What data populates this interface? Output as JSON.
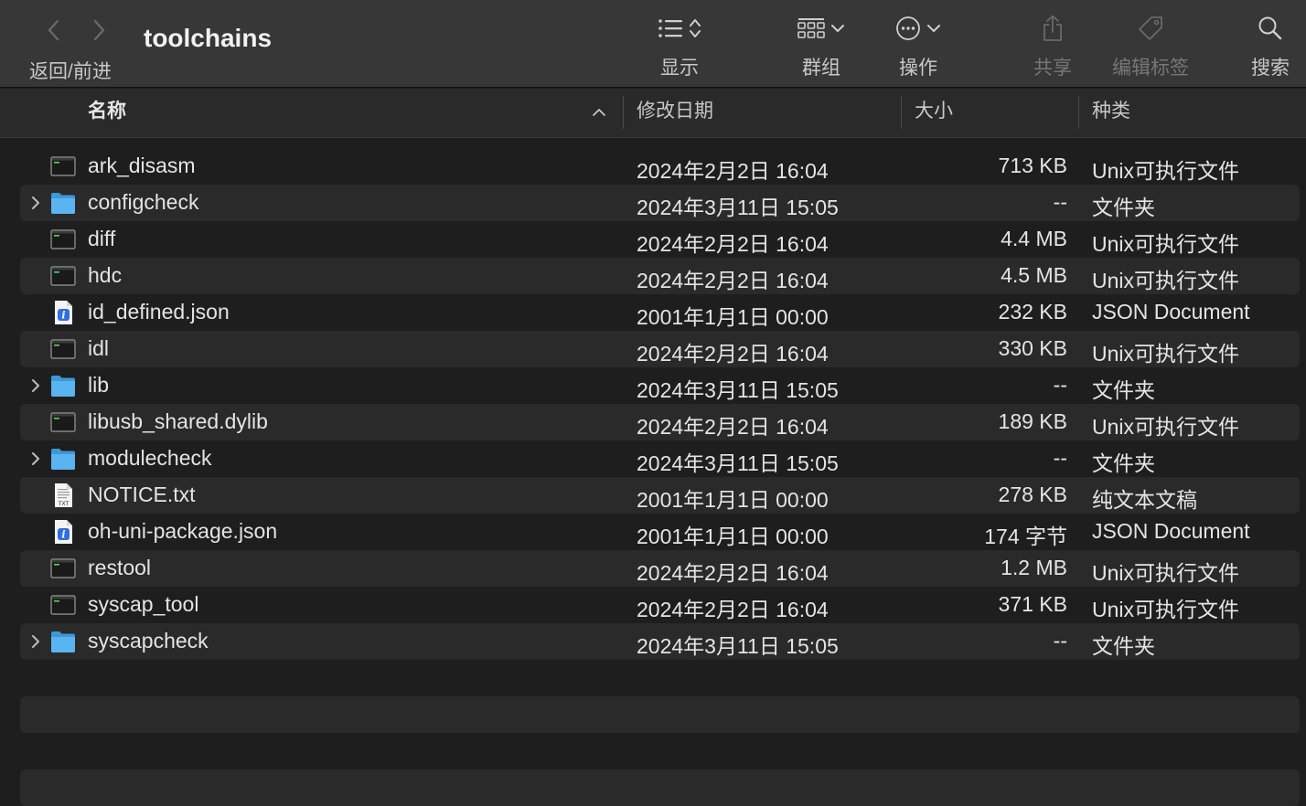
{
  "window": {
    "title": "toolchains",
    "nav_label": "返回/前进"
  },
  "toolbar": {
    "view_label": "显示",
    "group_label": "群组",
    "action_label": "操作",
    "share_label": "共享",
    "tags_label": "编辑标签",
    "search_label": "搜索"
  },
  "columns": {
    "name": "名称",
    "modified": "修改日期",
    "size": "大小",
    "kind": "种类"
  },
  "files": [
    {
      "name": "ark_disasm",
      "date": "2024年2月2日 16:04",
      "size": "713 KB",
      "kind": "Unix可执行文件",
      "icon": "exec-icon",
      "folder": false
    },
    {
      "name": "configcheck",
      "date": "2024年3月11日 15:05",
      "size": "--",
      "kind": "文件夹",
      "icon": "folder-icon",
      "folder": true
    },
    {
      "name": "diff",
      "date": "2024年2月2日 16:04",
      "size": "4.4 MB",
      "kind": "Unix可执行文件",
      "icon": "exec-icon",
      "folder": false
    },
    {
      "name": "hdc",
      "date": "2024年2月2日 16:04",
      "size": "4.5 MB",
      "kind": "Unix可执行文件",
      "icon": "exec-icon",
      "folder": false
    },
    {
      "name": "id_defined.json",
      "date": "2001年1月1日 00:00",
      "size": "232 KB",
      "kind": "JSON Document",
      "icon": "json-icon",
      "folder": false
    },
    {
      "name": "idl",
      "date": "2024年2月2日 16:04",
      "size": "330 KB",
      "kind": "Unix可执行文件",
      "icon": "exec-icon",
      "folder": false
    },
    {
      "name": "lib",
      "date": "2024年3月11日 15:05",
      "size": "--",
      "kind": "文件夹",
      "icon": "folder-icon",
      "folder": true
    },
    {
      "name": "libusb_shared.dylib",
      "date": "2024年2月2日 16:04",
      "size": "189 KB",
      "kind": "Unix可执行文件",
      "icon": "exec-icon",
      "folder": false
    },
    {
      "name": "modulecheck",
      "date": "2024年3月11日 15:05",
      "size": "--",
      "kind": "文件夹",
      "icon": "folder-icon",
      "folder": true
    },
    {
      "name": "NOTICE.txt",
      "date": "2001年1月1日 00:00",
      "size": "278 KB",
      "kind": "纯文本文稿",
      "icon": "txt-icon",
      "folder": false,
      "icon_text": "TXT"
    },
    {
      "name": "oh-uni-package.json",
      "date": "2001年1月1日 00:00",
      "size": "174 字节",
      "kind": "JSON Document",
      "icon": "json-icon",
      "folder": false
    },
    {
      "name": "restool",
      "date": "2024年2月2日 16:04",
      "size": "1.2 MB",
      "kind": "Unix可执行文件",
      "icon": "exec-icon",
      "folder": false
    },
    {
      "name": "syscap_tool",
      "date": "2024年2月2日 16:04",
      "size": "371 KB",
      "kind": "Unix可执行文件",
      "icon": "exec-icon",
      "folder": false
    },
    {
      "name": "syscapcheck",
      "date": "2024年3月11日 15:05",
      "size": "--",
      "kind": "文件夹",
      "icon": "folder-icon",
      "folder": true
    }
  ],
  "colors": {
    "folder": "#5ab4f0",
    "json_badge": "#2f6fe0",
    "background": "#1e1e1e",
    "alt_row": "#2a2a2a",
    "toolbar": "#373737"
  }
}
